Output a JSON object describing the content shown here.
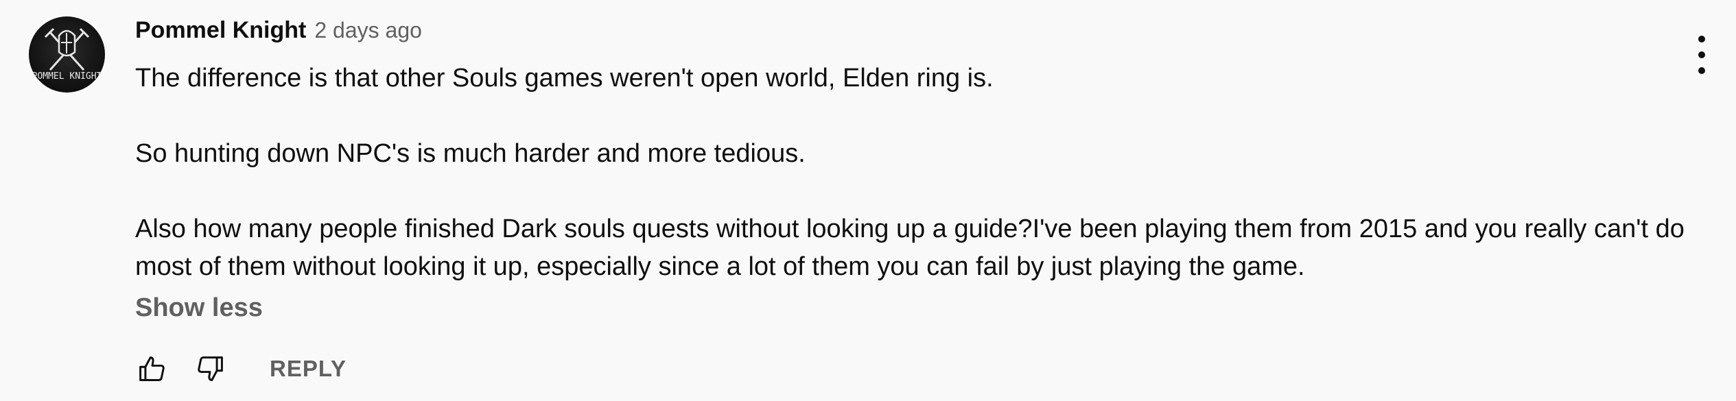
{
  "comment": {
    "author": "Pommel Knight",
    "time": "2 days ago",
    "avatar_text": "POMMEL KNIGHT",
    "paragraphs": [
      "The difference is that other Souls games weren't open world, Elden ring is.",
      "So hunting down NPC's is much harder and more tedious.",
      "Also how many people finished Dark souls quests without looking up a guide?I've been playing them from 2015 and you really can't do most of them without looking it up, especially since a lot of them you can fail by just playing the game."
    ],
    "show_less_label": "Show less",
    "reply_label": "REPLY",
    "icons": {
      "like": "thumbs-up-icon",
      "dislike": "thumbs-down-icon",
      "menu": "more-vertical-icon"
    },
    "colors": {
      "background": "#f9f9f9",
      "text": "#0f0f0f",
      "secondary": "#606060"
    }
  }
}
